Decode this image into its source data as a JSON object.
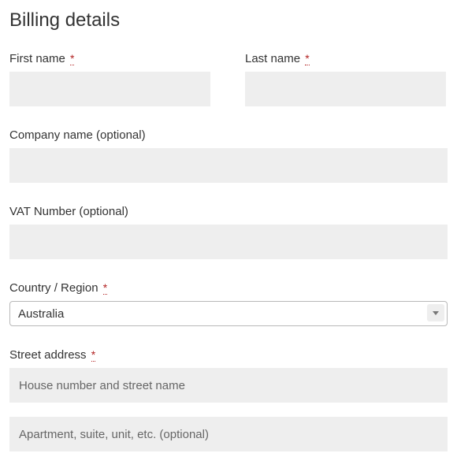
{
  "heading": "Billing details",
  "required_marker": "*",
  "fields": {
    "first_name": {
      "label": "First name",
      "value": ""
    },
    "last_name": {
      "label": "Last name",
      "value": ""
    },
    "company": {
      "label": "Company name (optional)",
      "value": ""
    },
    "vat": {
      "label": "VAT Number (optional)",
      "value": ""
    },
    "country": {
      "label": "Country / Region",
      "selected": "Australia"
    },
    "street": {
      "label": "Street address",
      "placeholder1": "House number and street name",
      "placeholder2": "Apartment, suite, unit, etc. (optional)"
    }
  }
}
